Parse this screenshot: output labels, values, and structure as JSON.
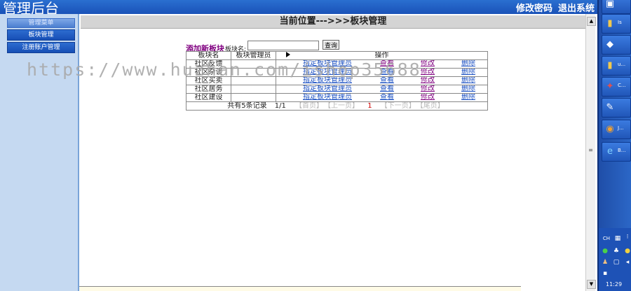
{
  "header": {
    "app_title": "管理后台",
    "change_password": "修改密码",
    "logout": "退出系统"
  },
  "sidebar": {
    "heading": "管理菜单",
    "items": [
      {
        "label": "板块管理"
      },
      {
        "label": "注册账户管理"
      }
    ]
  },
  "main": {
    "breadcrumb": "当前位置--->>>板块管理",
    "add_link": "添加新板块",
    "field_label": "板块名:",
    "search_value": "",
    "search_button": "查询",
    "columns": [
      "板块名",
      "板块管理员",
      "操作"
    ],
    "rows": [
      {
        "name": "社区反馈",
        "admin": "",
        "assign": "指定板块管理员",
        "view": "查看",
        "edit": "修改",
        "delete": "删除"
      },
      {
        "name": "社区杂谈",
        "admin": "",
        "assign": "指定板块管理员",
        "view": "查看",
        "edit": "修改",
        "delete": "删除"
      },
      {
        "name": "社区买卖",
        "admin": "",
        "assign": "指定板块管理员",
        "view": "查看",
        "edit": "修改",
        "delete": "删除"
      },
      {
        "name": "社区居务",
        "admin": "",
        "assign": "指定板块管理员",
        "view": "查看",
        "edit": "修改",
        "delete": "删除"
      },
      {
        "name": "社区建设",
        "admin": "",
        "assign": "指定板块管理员",
        "view": "查看",
        "edit": "修改",
        "delete": "删除"
      }
    ],
    "pager": {
      "total": "共有5条记录",
      "page": "1/1",
      "first": "【首页】",
      "prev": "【上一页】",
      "current": "1",
      "next": "【下一页】",
      "last": "【尾页】"
    }
  },
  "watermark": "https://www.huzhan.com/ishop35688",
  "taskbar": {
    "items": [
      {
        "icon": "folder-icon",
        "label": "Is"
      },
      {
        "icon": "drive-icon",
        "label": ""
      },
      {
        "icon": "folder-icon",
        "label": "u..."
      },
      {
        "icon": "app-icon",
        "label": "C..."
      },
      {
        "icon": "tool-icon",
        "label": ""
      },
      {
        "icon": "game-icon",
        "label": "J..."
      },
      {
        "icon": "ie-icon",
        "label": "B..."
      }
    ],
    "tray_lang": "CH",
    "clock": "11:29"
  }
}
